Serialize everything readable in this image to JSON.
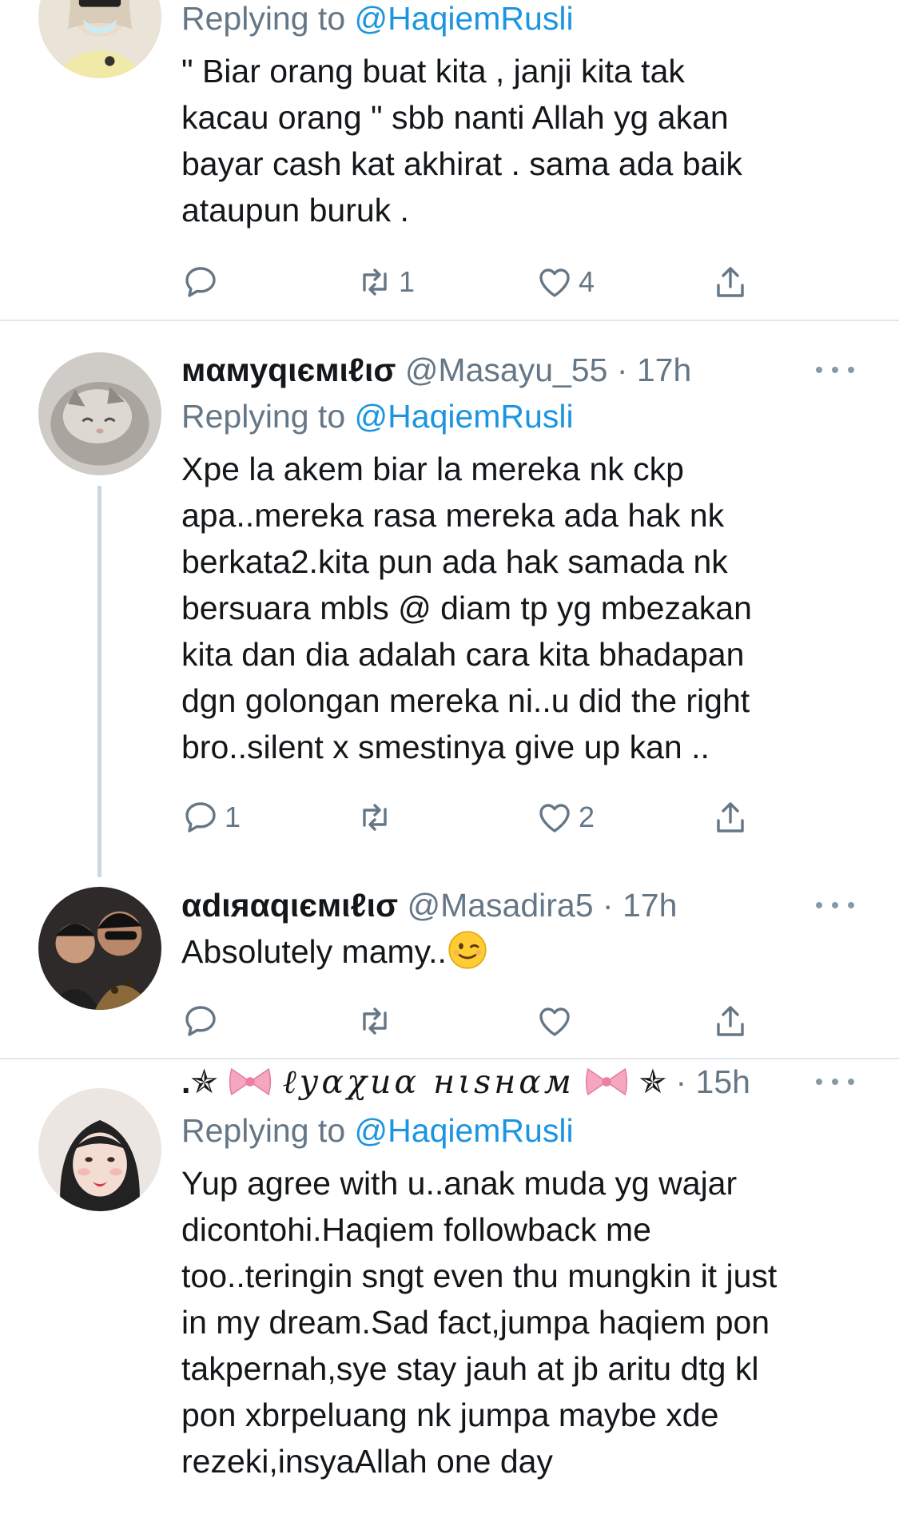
{
  "tweets": [
    {
      "reply_prefix": "Replying to",
      "reply_mention": "@HaqiemRusli",
      "lines": [
        "\" Biar orang buat kita ,  janji kita tak",
        "kacau orang \"  sbb nanti Allah yg akan",
        "bayar cash kat akhirat . sama ada baik",
        "ataupun buruk ."
      ],
      "counts": {
        "reply": "",
        "retweet": "1",
        "like": "4"
      }
    },
    {
      "name": "мαмуqιємιℓισ",
      "handle": "@Masayu_55",
      "dot": "·",
      "time": "17h",
      "reply_prefix": "Replying to",
      "reply_mention": "@HaqiemRusli",
      "lines": [
        "Xpe la akem biar la mereka nk ckp",
        "apa..mereka rasa mereka ada hak nk",
        "berkata2.kita pun ada hak samada nk",
        "bersuara mbls @ diam tp yg mbezakan",
        "kita dan dia adalah cara kita bhadapan",
        "dgn golongan mereka ni..u did the right",
        "bro..silent x smestinya give up kan .."
      ],
      "counts": {
        "reply": "1",
        "retweet": "",
        "like": "2"
      }
    },
    {
      "name": "αdιяαqιємιℓισ",
      "handle": "@Masadira5",
      "dot": "·",
      "time": "17h",
      "text": "Absolutely mamy..",
      "emoji": "winking-face",
      "counts": {
        "reply": "",
        "retweet": "",
        "like": ""
      }
    },
    {
      "name_prefix": ".✯",
      "name_core": "ℓуαχиα нιѕнαм",
      "name_suffix": "✯",
      "dot": "·",
      "time": "15h",
      "reply_prefix": "Replying to",
      "reply_mention": "@HaqiemRusli",
      "lines": [
        "Yup agree with u..anak muda yg wajar",
        "dicontohi.Haqiem followback me",
        "too..teringin sngt even thu mungkin it just",
        "in my dream.Sad fact,jumpa haqiem pon",
        "takpernah,sye stay jauh at jb aritu dtg kl",
        "pon xbrpeluang nk jumpa maybe xde",
        "rezeki,insyaAllah one day"
      ]
    }
  ],
  "colors": {
    "text": "#14171a",
    "secondary": "#657786",
    "link": "#1b95e0",
    "divider": "#e1e8ed",
    "thread": "#ccd6dd"
  },
  "icons": [
    "reply-icon",
    "retweet-icon",
    "like-icon",
    "share-icon",
    "more-icon",
    "ribbon-icon"
  ]
}
